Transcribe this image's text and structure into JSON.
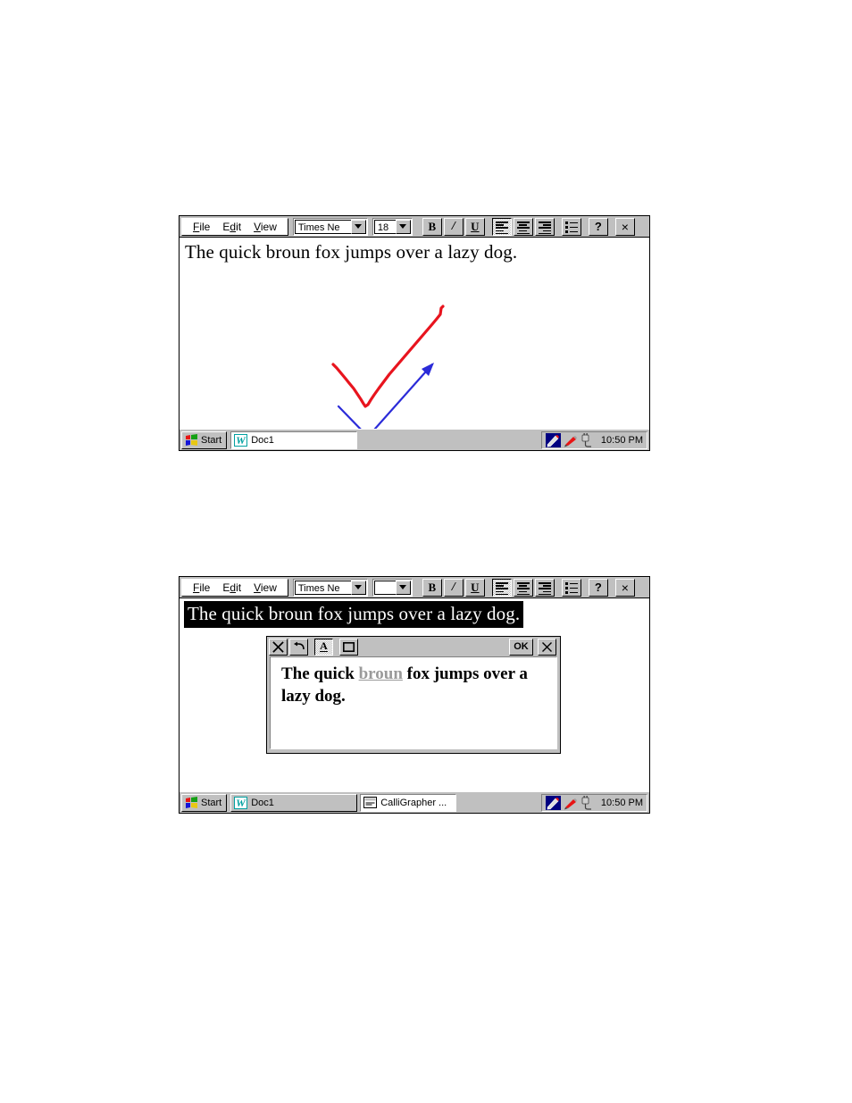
{
  "figures": [
    {
      "id": "figure-top",
      "window": {
        "title_absent": true,
        "toolbar": {
          "menus": [
            {
              "label": "File",
              "accel": "F"
            },
            {
              "label": "Edit",
              "accel": "E"
            },
            {
              "label": "View",
              "accel": "V"
            }
          ],
          "font_name": "Times Ne",
          "font_size": "18",
          "buttons": [
            {
              "name": "bold-button",
              "label": "B"
            },
            {
              "name": "italic-button",
              "label": "I"
            },
            {
              "name": "underline-button",
              "label": "U"
            },
            {
              "name": "align-left-button",
              "label": "",
              "pressed": true
            },
            {
              "name": "align-center-button",
              "label": ""
            },
            {
              "name": "align-right-button",
              "label": ""
            },
            {
              "name": "bullet-list-button",
              "label": ""
            },
            {
              "name": "help-button",
              "label": "?"
            },
            {
              "name": "close-button",
              "label": "×"
            }
          ]
        },
        "document_text": "The quick broun fox jumps over a lazy dog.",
        "ink": {
          "red_stroke_color": "#e8141e",
          "blue_arrow_color": "#2b2bd8",
          "red_label": "red-check-ink-stroke",
          "blue_label": "blue-arrow-ink-stroke"
        }
      },
      "taskbar": {
        "start_label": "Start",
        "items": [
          {
            "name": "taskbar-item-doc1",
            "label": "Doc1",
            "icon": "word-icon",
            "active": false
          }
        ],
        "tray": {
          "icons": [
            "pen-tablet-icon",
            "ink-pen-icon",
            "power-plug-icon"
          ],
          "clock": "10:50 PM"
        }
      }
    },
    {
      "id": "figure-bottom",
      "window": {
        "toolbar": {
          "menus": [
            {
              "label": "File",
              "accel": "F"
            },
            {
              "label": "Edit",
              "accel": "E"
            },
            {
              "label": "View",
              "accel": "V"
            }
          ],
          "font_name": "Times Ne",
          "font_size": "",
          "buttons": [
            {
              "name": "bold-button",
              "label": "B"
            },
            {
              "name": "italic-button",
              "label": "I"
            },
            {
              "name": "underline-button",
              "label": "U"
            },
            {
              "name": "align-left-button",
              "label": "",
              "pressed": true
            },
            {
              "name": "align-center-button",
              "label": ""
            },
            {
              "name": "align-right-button",
              "label": ""
            },
            {
              "name": "bullet-list-button",
              "label": ""
            },
            {
              "name": "help-button",
              "label": "?"
            },
            {
              "name": "close-button",
              "label": "×"
            }
          ]
        },
        "document_text": "The quick broun fox jumps over a lazy dog.",
        "document_text_selected": true
      },
      "dialog": {
        "name": "calligrapher-recognition-dialog",
        "buttons": [
          {
            "name": "clear-button",
            "label": "×"
          },
          {
            "name": "undo-button",
            "label": "↩"
          },
          {
            "name": "text-mode-button",
            "label": "A",
            "pressed": true
          },
          {
            "name": "box-mode-button",
            "label": "□"
          },
          {
            "name": "ok-button",
            "label": "OK"
          },
          {
            "name": "close-button",
            "label": "×"
          }
        ],
        "text_before": "The quick ",
        "text_misspelled": "broun",
        "text_after": " fox jumps over a lazy dog."
      },
      "taskbar": {
        "start_label": "Start",
        "items": [
          {
            "name": "taskbar-item-doc1",
            "label": "Doc1",
            "icon": "word-icon",
            "active": true
          },
          {
            "name": "taskbar-item-calligrapher",
            "label": "CalliGrapher ...",
            "icon": "calligrapher-icon",
            "active": false
          }
        ],
        "tray": {
          "icons": [
            "pen-tablet-icon",
            "ink-pen-icon",
            "power-plug-icon"
          ],
          "clock": "10:50 PM"
        }
      }
    }
  ],
  "colors": {
    "face": "#c0c0c0",
    "white": "#ffffff",
    "black": "#000000",
    "shadow": "#808080",
    "ink_red": "#e8141e",
    "ink_blue": "#2b2bd8",
    "misspell_gray": "#9a9a9a"
  }
}
